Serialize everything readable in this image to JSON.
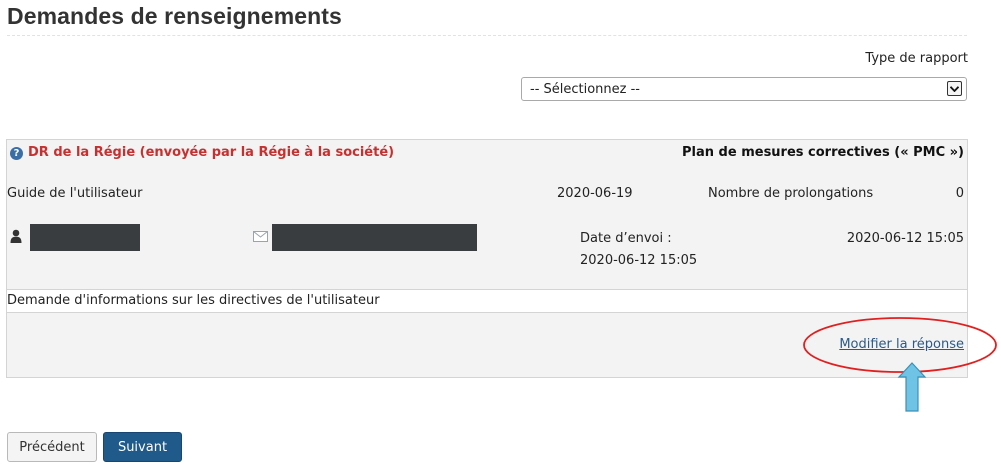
{
  "page": {
    "title": "Demandes de renseignements"
  },
  "report_filter": {
    "label": "Type de rapport",
    "selected": "-- Sélectionnez --"
  },
  "request": {
    "heading": "DR de la Régie (envoyée par la Régie à la société)",
    "plan_title": "Plan de mesures correctives (« PMC »)",
    "guide_label": "Guide de l'utilisateur",
    "guide_date": "2020-06-19",
    "prolongations_label": "Nombre de prolongations",
    "prolongations_value": "0",
    "sent_label": "Date d’envoi :",
    "sent_value": "2020-06-12 15:05",
    "sent_value_right": "2020-06-12 15:05",
    "description": "Demande d'informations sur les directives de l'utilisateur",
    "modify_link": "Modifier la réponse"
  },
  "icons": {
    "help": "help-icon",
    "user": "user-icon",
    "mail": "mail-icon",
    "dropdown": "chevron-down-icon"
  },
  "nav": {
    "prev_label": "Précédent",
    "next_label": "Suivant"
  },
  "colors": {
    "heading_red": "#c83030",
    "link_blue": "#2a5a8a",
    "next_button": "#1f5a8a",
    "annotation_red": "#e02020",
    "annotation_arrow": "#6fc4e6"
  }
}
